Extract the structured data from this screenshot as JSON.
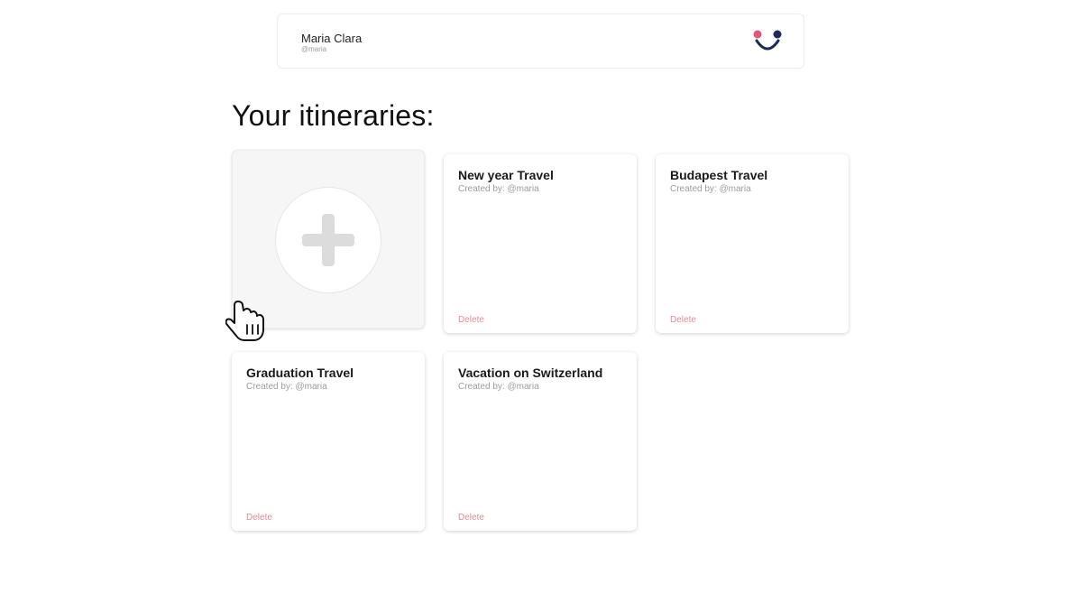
{
  "profile": {
    "name": "Maria Clara",
    "handle": "@maria",
    "logo_colors": {
      "dot_left": "#e0557a",
      "dot_right": "#1e2a5a",
      "smile": "#1e2a5a"
    }
  },
  "main": {
    "title": "Your itineraries:",
    "add_card_icon": "plus-icon",
    "itineraries": [
      {
        "title": "New year Travel",
        "creator": "Created by: @maria",
        "delete_label": "Delete"
      },
      {
        "title": "Budapest Travel",
        "creator": "Created by: @maria",
        "delete_label": "Delete"
      },
      {
        "title": "Graduation Travel",
        "creator": "Created by: @maria",
        "delete_label": "Delete"
      },
      {
        "title": "Vacation on Switzerland",
        "creator": "Created by: @maria",
        "delete_label": "Delete"
      }
    ]
  },
  "colors": {
    "delete": "#e58a9a",
    "muted": "#9c9c9c",
    "add_card_bg": "#f6f6f6"
  }
}
